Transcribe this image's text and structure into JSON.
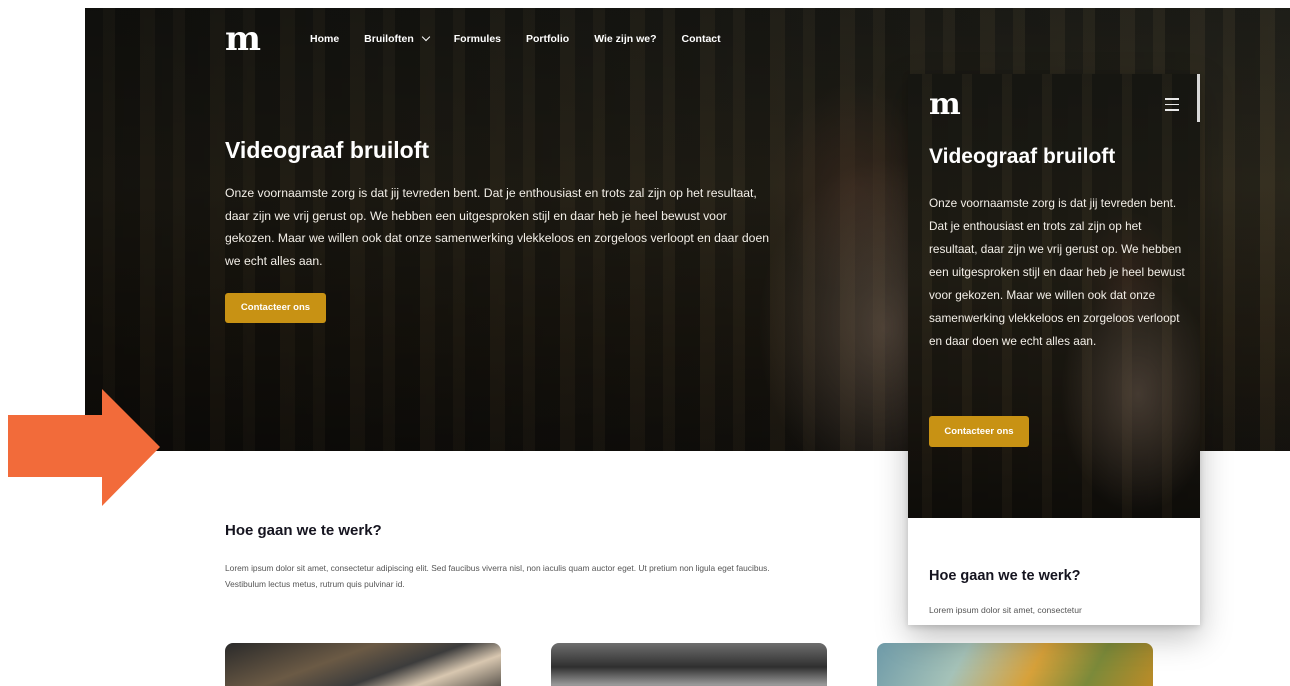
{
  "brand": {
    "logo": "m"
  },
  "nav": {
    "items": [
      {
        "label": "Home"
      },
      {
        "label": "Bruiloften"
      },
      {
        "label": "Formules"
      },
      {
        "label": "Portfolio"
      },
      {
        "label": "Wie zijn we?"
      },
      {
        "label": "Contact"
      }
    ]
  },
  "hero": {
    "title": "Videograaf bruiloft",
    "text": "Onze voornaamste zorg is dat jij tevreden bent. Dat je enthousiast en trots zal zijn op het resultaat, daar zijn we vrij gerust op. We hebben een uitgesproken stijl en daar heb je heel bewust voor gekozen. Maar we willen ook dat onze samenwerking vlekkeloos en zorgeloos verloopt en daar doen we echt alles aan.",
    "button": "Contacteer ons"
  },
  "section": {
    "title": "Hoe gaan we te werk?",
    "text": "Lorem ipsum dolor sit amet, consectetur adipiscing elit. Sed faucibus viverra nisl, non iaculis quam auctor eget. Ut pretium non ligula eget faucibus. Vestibulum lectus metus, rutrum quis pulvinar id.",
    "mobile_text": "Lorem ipsum dolor sit amet, consectetur"
  },
  "colors": {
    "accent": "#c89214",
    "arrow": "#f26b3a",
    "heading": "#15141f"
  }
}
